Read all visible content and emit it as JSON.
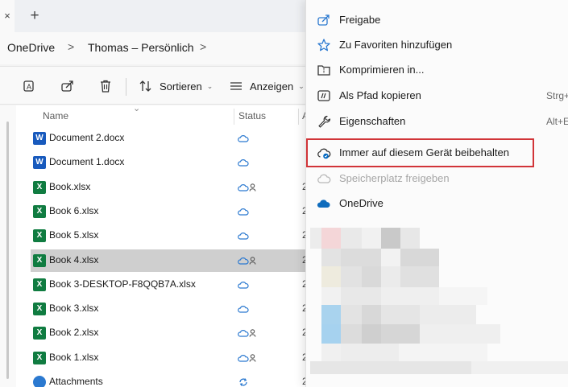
{
  "tabbar": {
    "close_glyph": "×",
    "new_tab_glyph": "+"
  },
  "breadcrumb": {
    "root": "OneDrive",
    "folder": "Thomas – Persönlich",
    "separator": ">"
  },
  "toolbar": {
    "sort_label": "Sortieren",
    "view_label": "Anzeigen"
  },
  "columns": {
    "name": "Name",
    "status": "Status",
    "next_truncated": "A"
  },
  "files": [
    {
      "name": "Document 2.docx",
      "type": "word",
      "status": "cloud",
      "shared": false,
      "col3": ""
    },
    {
      "name": "Document 1.docx",
      "type": "word",
      "status": "cloud",
      "shared": false,
      "col3": ""
    },
    {
      "name": "Book.xlsx",
      "type": "excel",
      "status": "cloud",
      "shared": true,
      "col3": "2"
    },
    {
      "name": "Book 6.xlsx",
      "type": "excel",
      "status": "cloud",
      "shared": false,
      "col3": "2"
    },
    {
      "name": "Book 5.xlsx",
      "type": "excel",
      "status": "cloud",
      "shared": false,
      "col3": "2"
    },
    {
      "name": "Book 4.xlsx",
      "type": "excel",
      "status": "cloud",
      "shared": true,
      "col3": "2",
      "selected": true
    },
    {
      "name": "Book 3-DESKTOP-F8QQB7A.xlsx",
      "type": "excel",
      "status": "cloud",
      "shared": false,
      "col3": "2"
    },
    {
      "name": "Book 3.xlsx",
      "type": "excel",
      "status": "cloud",
      "shared": false,
      "col3": "2"
    },
    {
      "name": "Book 2.xlsx",
      "type": "excel",
      "status": "cloud",
      "shared": true,
      "col3": "2"
    },
    {
      "name": "Book 1.xlsx",
      "type": "excel",
      "status": "cloud",
      "shared": true,
      "col3": "2"
    },
    {
      "name": "Attachments",
      "type": "attach",
      "status": "sync",
      "shared": false,
      "col3": "2"
    }
  ],
  "context_menu": {
    "share": "Freigabe",
    "favorites": "Zu Favoriten hinzufügen",
    "compress": "Komprimieren in...",
    "copy_path": "Als Pfad kopieren",
    "copy_path_shortcut": "Strg+",
    "properties": "Eigenschaften",
    "properties_shortcut": "Alt+E",
    "always_keep": "Immer auf diesem Gerät beibehalten",
    "free_space": "Speicherplatz freigeben",
    "onedrive": "OneDrive"
  },
  "colors": {
    "accent": "#0067c0",
    "highlight_border": "#d13438",
    "excel": "#107c41",
    "word": "#185abd"
  }
}
